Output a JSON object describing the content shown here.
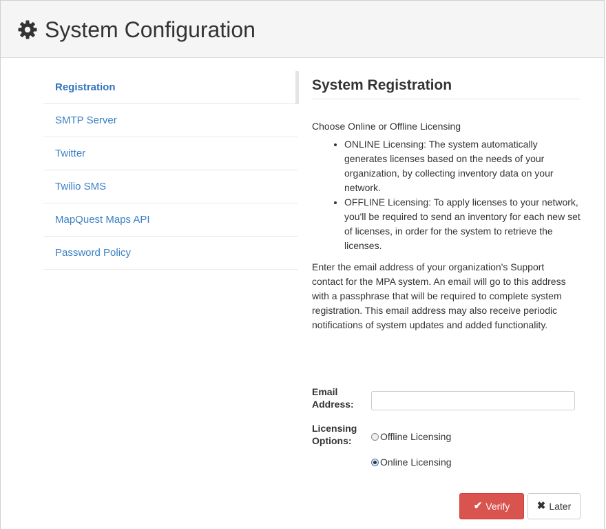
{
  "header": {
    "title": "System Configuration",
    "icon": "gear-icon"
  },
  "sidebar": {
    "items": [
      {
        "label": "Registration",
        "active": true
      },
      {
        "label": "SMTP Server",
        "active": false
      },
      {
        "label": "Twitter",
        "active": false
      },
      {
        "label": "Twilio SMS",
        "active": false
      },
      {
        "label": "MapQuest Maps API",
        "active": false
      },
      {
        "label": "Password Policy",
        "active": false
      }
    ]
  },
  "main": {
    "title": "System Registration",
    "lead": "Choose Online or Offline Licensing",
    "bullets": [
      "ONLINE Licensing: The system automatically generates licenses based on the needs of your organization, by collecting inventory data on your network.",
      "OFFLINE Licensing: To apply licenses to your network, you'll be required to send an inventory for each new set of licenses, in order for the system to retrieve the licenses."
    ],
    "description": "Enter the email address of your organization's Support contact for the MPA system. An email will go to this address with a passphrase that will be required to complete system registration. This email address may also receive periodic notifications of system updates and added functionality."
  },
  "form": {
    "email_label_line1": "Email",
    "email_label_line2": "Address:",
    "email_value": "",
    "licensing_label_line1": "Licensing",
    "licensing_label_line2": "Options:",
    "options": [
      {
        "label": "Offline Licensing",
        "checked": false
      },
      {
        "label": "Online Licensing",
        "checked": true
      }
    ]
  },
  "buttons": {
    "verify_label": "Verify",
    "later_label": "Later"
  },
  "colors": {
    "link": "#3a7fc4",
    "danger": "#d9534f",
    "header_bg": "#f5f5f5"
  }
}
